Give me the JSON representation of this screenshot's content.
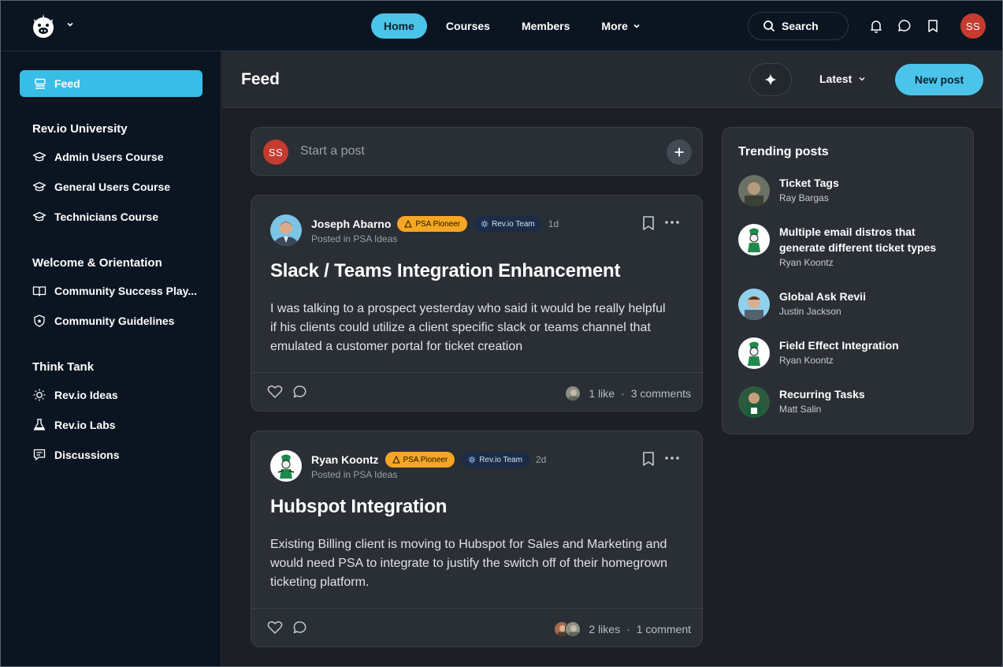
{
  "topbar": {
    "nav": [
      {
        "label": "Home",
        "active": true
      },
      {
        "label": "Courses",
        "active": false
      },
      {
        "label": "Members",
        "active": false
      },
      {
        "label": "More",
        "active": false
      }
    ],
    "search_label": "Search",
    "user_initials": "SS",
    "icons": [
      "bell-icon",
      "chat-icon",
      "bookmark-icon"
    ]
  },
  "sidebar": {
    "feed_label": "Feed",
    "sections": [
      {
        "title": "Rev.io University",
        "items": [
          {
            "label": "Admin Users Course",
            "icon": "graduation-cap-icon"
          },
          {
            "label": "General Users Course",
            "icon": "graduation-cap-icon"
          },
          {
            "label": "Technicians Course",
            "icon": "graduation-cap-icon"
          }
        ]
      },
      {
        "title": "Welcome & Orientation",
        "items": [
          {
            "label": "Community Success Play...",
            "icon": "book-open-icon"
          },
          {
            "label": "Community Guidelines",
            "icon": "shield-icon"
          }
        ]
      },
      {
        "title": "Think Tank",
        "items": [
          {
            "label": "Rev.io Ideas",
            "icon": "lightbulb-icon"
          },
          {
            "label": "Rev.io Labs",
            "icon": "flask-icon"
          },
          {
            "label": "Discussions",
            "icon": "discussion-icon"
          }
        ]
      }
    ]
  },
  "header": {
    "title": "Feed",
    "sort_label": "Latest",
    "new_post_label": "New post"
  },
  "composer": {
    "initials": "SS",
    "placeholder": "Start a post"
  },
  "posts": [
    {
      "author": "Joseph Abarno",
      "badge1": "PSA Pioneer",
      "badge2": "Rev.io Team",
      "time": "1d",
      "posted_in": "Posted in PSA Ideas",
      "title": "Slack / Teams Integration Enhancement",
      "body": "I was talking to a prospect yesterday who said it would be really helpful if his clients could utilize a client specific slack or teams channel that emulated a customer portal for ticket creation",
      "likes": "1 like",
      "comments": "3 comments"
    },
    {
      "author": "Ryan Koontz",
      "badge1": "PSA Pioneer",
      "badge2": "Rev.io Team",
      "time": "2d",
      "posted_in": "Posted in PSA Ideas",
      "title": "Hubspot Integration",
      "body": "Existing Billing client is moving to Hubspot for Sales and Marketing and would need PSA to integrate to justify the switch off of their homegrown ticketing platform.",
      "likes": "2 likes",
      "comments": "1 comment"
    }
  ],
  "trending": {
    "title": "Trending posts",
    "items": [
      {
        "name": "Ticket Tags",
        "author": "Ray Bargas"
      },
      {
        "name": "Multiple email distros that generate different ticket types",
        "author": "Ryan Koontz"
      },
      {
        "name": "Global Ask Revii",
        "author": "Justin Jackson"
      },
      {
        "name": "Field Effect Integration",
        "author": "Ryan Koontz"
      },
      {
        "name": "Recurring Tasks",
        "author": "Matt Salin"
      }
    ]
  },
  "colors": {
    "accent": "#4cc4ea",
    "sidebar_bg": "#0b1522",
    "main_bg": "#1c1f24",
    "card_bg": "#2a2e35",
    "pioneer_badge": "#f5a623",
    "avatar_red": "#c63b2f"
  }
}
